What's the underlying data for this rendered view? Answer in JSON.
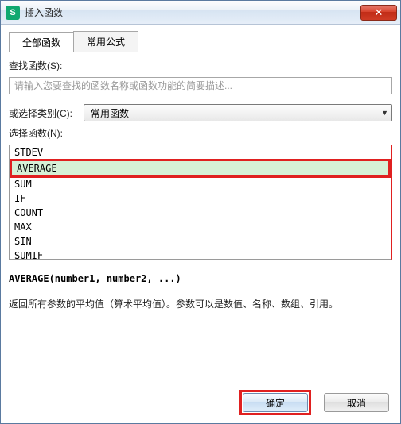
{
  "window": {
    "title": "插入函数",
    "app_icon_letter": "S"
  },
  "tabs": {
    "all_functions": "全部函数",
    "common_formulas": "常用公式"
  },
  "search": {
    "label": "查找函数(S):",
    "placeholder": "请输入您要查找的函数名称或函数功能的简要描述..."
  },
  "category": {
    "label": "或选择类别(C):",
    "selected": "常用函数"
  },
  "select_function_label": "选择函数(N):",
  "functions": {
    "items": [
      "STDEV",
      "AVERAGE",
      "SUM",
      "IF",
      "COUNT",
      "MAX",
      "SIN",
      "SUMIF"
    ],
    "selected_index": 1
  },
  "signature": "AVERAGE(number1, number2, ...)",
  "description": "返回所有参数的平均值（算术平均值）。参数可以是数值、名称、数组、引用。",
  "buttons": {
    "ok": "确定",
    "cancel": "取消"
  }
}
